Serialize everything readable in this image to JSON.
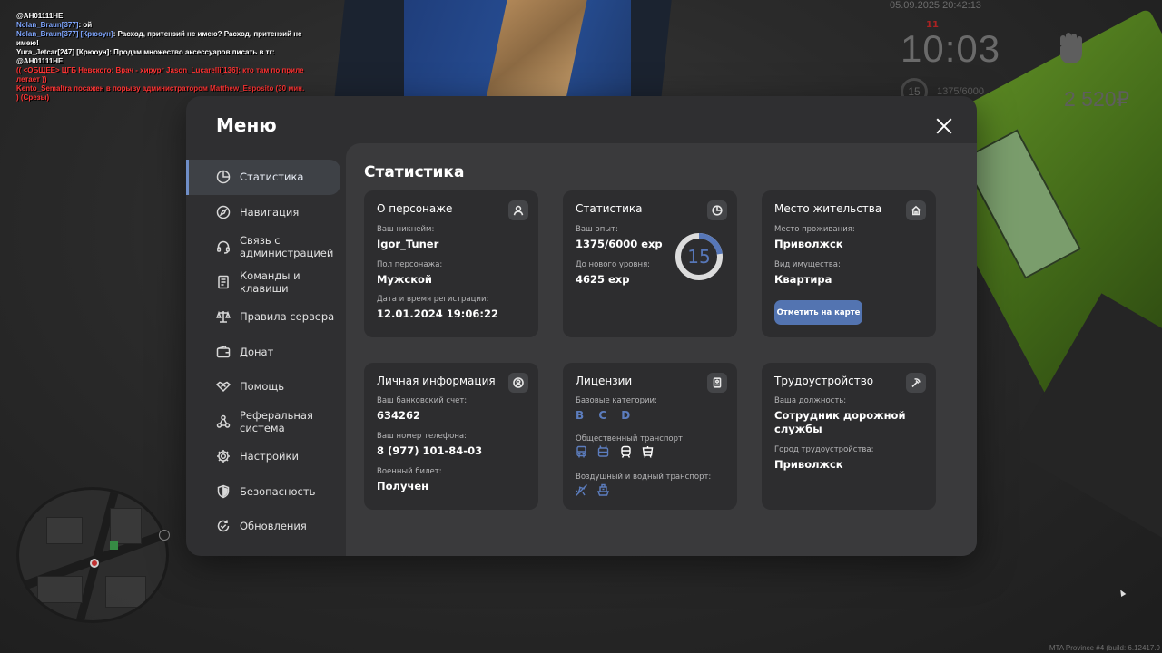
{
  "chat": [
    {
      "parts": [
        {
          "text": "@AH01111HE",
          "color": "white"
        }
      ]
    },
    {
      "parts": [
        {
          "text": "Nolan_Braun[377]",
          "color": "blue"
        },
        {
          "text": ": ой",
          "color": "white"
        }
      ]
    },
    {
      "parts": [
        {
          "text": "Nolan_Braun[377] [Крюоун]",
          "color": "blue"
        },
        {
          "text": ": Расход, притензий не имею? Расход, притензий не имею!",
          "color": "white"
        }
      ]
    },
    {
      "parts": [
        {
          "text": "Yura_Jetcar[247] [Крюоун]: Продам множество аксессуаров писать в тг: @AH01111HE",
          "color": "white"
        }
      ]
    },
    {
      "parts": [
        {
          "text": "(( <ОБЩЕЕ> ЦГБ Невского: Врач - хирург Jason_Lucarelli[136]: кто там по приле летает ))",
          "color": "red"
        }
      ]
    },
    {
      "parts": [
        {
          "text": "Kento_Semaltra посажен в порыву администратором Matthew_Esposito (30 мин. ) (Срезы)",
          "color": "red"
        }
      ]
    }
  ],
  "hud": {
    "datetime": "05.09.2025 20:42:13",
    "red_number": "11",
    "time": "10:03",
    "level": "15",
    "exp": "1375/6000",
    "money": "2 520₽",
    "fist_icon": "fist-icon"
  },
  "watermark": "MTA Province #4 (build: 6.12417.9",
  "menu": {
    "title": "Меню",
    "close_icon": "close-icon",
    "sidebar": [
      {
        "label": "Статистика",
        "icon": "pie-chart-icon",
        "active": true
      },
      {
        "label": "Навигация",
        "icon": "compass-icon"
      },
      {
        "label": "Связь с администрацией",
        "icon": "headset-icon"
      },
      {
        "label": "Команды и клавиши",
        "icon": "document-icon"
      },
      {
        "label": "Правила сервера",
        "icon": "scales-icon"
      },
      {
        "label": "Донат",
        "icon": "wallet-icon"
      },
      {
        "label": "Помощь",
        "icon": "handshake-icon"
      },
      {
        "label": "Реферальная система",
        "icon": "network-icon"
      },
      {
        "label": "Настройки",
        "icon": "gear-icon"
      },
      {
        "label": "Безопасность",
        "icon": "shield-icon"
      },
      {
        "label": "Обновления",
        "icon": "refresh-check-icon"
      }
    ],
    "content_title": "Статистика",
    "cards": {
      "character": {
        "title": "О персонаже",
        "icon": "user-icon",
        "nickname_label": "Ваш никнейм:",
        "nickname": "Igor_Tuner",
        "gender_label": "Пол персонажа:",
        "gender": "Мужской",
        "reg_label": "Дата и время регистрации:",
        "reg": "12.01.2024 19:06:22"
      },
      "stats": {
        "title": "Статистика",
        "icon": "pie-chart-icon",
        "exp_label": "Ваш опыт:",
        "exp": "1375/6000 exp",
        "next_label": "До нового уровня:",
        "next": "4625 exp",
        "level": "15",
        "progress": 0.229,
        "ring_color": "#5777b8",
        "ring_track": "#dcdcdc"
      },
      "residence": {
        "title": "Место жительства",
        "icon": "home-icon",
        "place_label": "Место проживания:",
        "place": "Приволжск",
        "prop_label": "Вид имущества:",
        "prop": "Квартира",
        "button": "Отметить на карте"
      },
      "personal": {
        "title": "Личная информация",
        "icon": "user-circle-icon",
        "bank_label": "Ваш банковский счет:",
        "bank": "634262",
        "phone_label": "Ваш номер телефона:",
        "phone": "8 (977) 101-84-03",
        "military_label": "Военный билет:",
        "military": "Получен"
      },
      "licenses": {
        "title": "Лицензии",
        "icon": "id-badge-icon",
        "base_label": "Базовые категории:",
        "base": "B C D",
        "public_label": "Общественный транспорт:",
        "public_icons": [
          "bus-icon",
          "trolleybus-icon",
          "train-icon",
          "tram-icon"
        ],
        "air_label": "Воздушный и водный транспорт:",
        "air_icons": [
          "plane-icon",
          "boat-icon"
        ],
        "accent": "#5c7dbe"
      },
      "job": {
        "title": "Трудоустройство",
        "icon": "pickaxe-icon",
        "position_label": "Ваша должность:",
        "position": "Сотрудник дорожной службы",
        "city_label": "Город трудоустройства:",
        "city": "Приволжск"
      }
    }
  }
}
